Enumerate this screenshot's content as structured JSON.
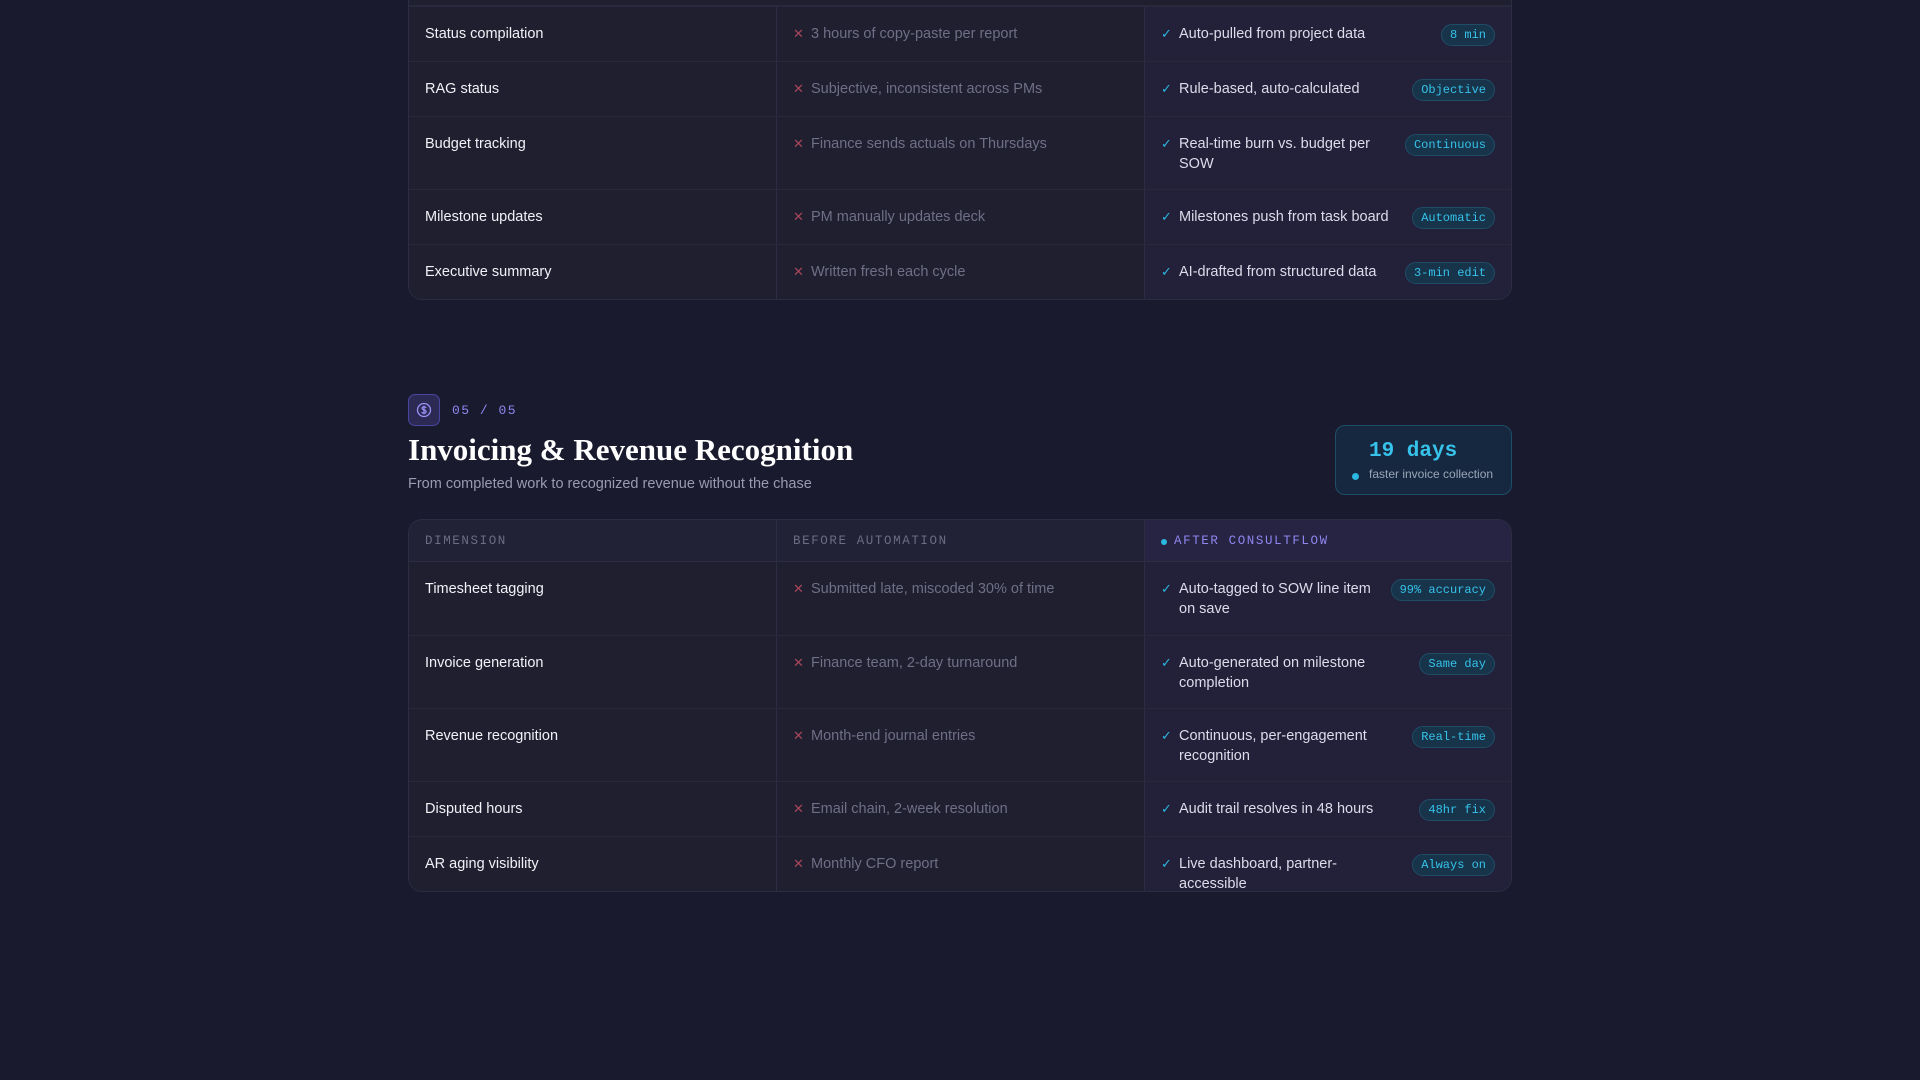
{
  "section4": {
    "rows": [
      {
        "dimension": "Status compilation",
        "before": "3 hours of copy-paste per report",
        "after": "Auto-pulled from project data",
        "badge": "8 min"
      },
      {
        "dimension": "RAG status",
        "before": "Subjective, inconsistent across PMs",
        "after": "Rule-based, auto-calculated",
        "badge": "Objective"
      },
      {
        "dimension": "Budget tracking",
        "before": "Finance sends actuals on Thursdays",
        "after": "Real-time burn vs. budget per SOW",
        "badge": "Continuous"
      },
      {
        "dimension": "Milestone updates",
        "before": "PM manually updates deck",
        "after": "Milestones push from task board",
        "badge": "Automatic"
      },
      {
        "dimension": "Executive summary",
        "before": "Written fresh each cycle",
        "after": "AI-drafted from structured data",
        "badge": "3-min edit"
      }
    ]
  },
  "section5": {
    "icon": "dollar-icon",
    "counter": "05 / 05",
    "title": "Invoicing & Revenue Recognition",
    "subtitle": "From completed work to recognized revenue without the chase",
    "metric": {
      "value": "19 days",
      "label": "faster invoice collection"
    },
    "headers": {
      "dimension": "DIMENSION",
      "before": "BEFORE AUTOMATION",
      "after": "AFTER CONSULTFLOW"
    },
    "rows": [
      {
        "dimension": "Timesheet tagging",
        "before": "Submitted late, miscoded 30% of time",
        "after": "Auto-tagged to SOW line item on save",
        "badge": "99% accuracy"
      },
      {
        "dimension": "Invoice generation",
        "before": "Finance team, 2-day turnaround",
        "after": "Auto-generated on milestone completion",
        "badge": "Same day"
      },
      {
        "dimension": "Revenue recognition",
        "before": "Month-end journal entries",
        "after": "Continuous, per-engagement recognition",
        "badge": "Real-time"
      },
      {
        "dimension": "Disputed hours",
        "before": "Email chain, 2-week resolution",
        "after": "Audit trail resolves in 48 hours",
        "badge": "48hr fix"
      },
      {
        "dimension": "AR aging visibility",
        "before": "Monthly CFO report",
        "after": "Live dashboard, partner-accessible",
        "badge": "Always on"
      }
    ]
  },
  "icons": {
    "cross": "✕",
    "check": "✓"
  }
}
